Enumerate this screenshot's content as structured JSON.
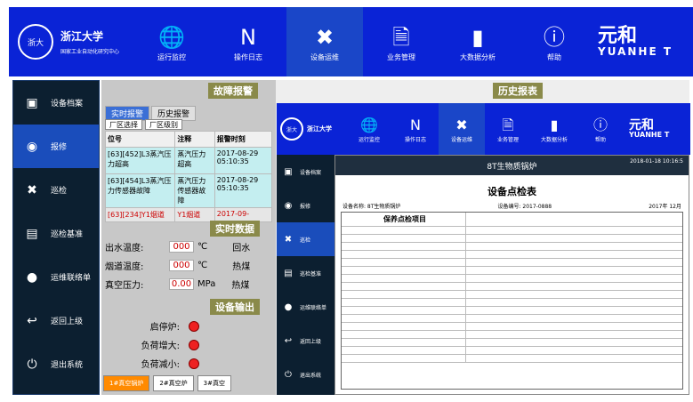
{
  "top": {
    "school": "浙江大学",
    "school_sub": "国家工业自动化研究中心",
    "logo_text": "浙大",
    "nav": [
      {
        "label": "运行监控",
        "icon": "globe-icon",
        "glyph": "🌐"
      },
      {
        "label": "操作日志",
        "icon": "notebook-icon",
        "glyph": "N"
      },
      {
        "label": "设备运维",
        "icon": "tools-icon",
        "glyph": "✖"
      },
      {
        "label": "业务管理",
        "icon": "document-search-icon",
        "glyph": "🗎"
      },
      {
        "label": "大数据分析",
        "icon": "bar-chart-icon",
        "glyph": "▮"
      },
      {
        "label": "帮助",
        "icon": "info-icon",
        "glyph": "ⓘ"
      }
    ],
    "brand_cn": "元和",
    "brand_en": "YUANHE T"
  },
  "sidebar": [
    {
      "label": "设备档案",
      "icon": "archive-icon",
      "glyph": "▣"
    },
    {
      "label": "报修",
      "icon": "repair-icon",
      "glyph": "◉"
    },
    {
      "label": "巡检",
      "icon": "inspection-icon",
      "glyph": "✖"
    },
    {
      "label": "巡检基准",
      "icon": "standard-icon",
      "glyph": "▤"
    },
    {
      "label": "运维联络单",
      "icon": "contact-icon",
      "glyph": "●"
    },
    {
      "label": "返回上级",
      "icon": "back-icon",
      "glyph": "↩"
    },
    {
      "label": "退出系统",
      "icon": "power-icon",
      "glyph": "⏻"
    }
  ],
  "fault": {
    "title": "故障报警",
    "tabs": [
      "实时报警",
      "历史报警"
    ],
    "filters": [
      "厂区选择",
      "厂区级别"
    ],
    "cols": [
      "位号",
      "注释",
      "报警时刻"
    ],
    "rows": [
      {
        "tag": "[63][452]L3蒸汽压力超高",
        "note": "蒸汽压力超高",
        "time": "2017-08-29 05:10:35"
      },
      {
        "tag": "[63][454]L3蒸汽压力传感器故障",
        "note": "蒸汽压力传感器故障",
        "time": "2017-08-29 05:10:35"
      },
      {
        "tag": "[63][234]Y1烟道",
        "note": "Y1烟道",
        "time": "2017-09-"
      }
    ]
  },
  "realtime": {
    "title": "实时数据",
    "items": [
      {
        "label": "出水温度:",
        "value": "000",
        "unit": "℃",
        "right": "回水"
      },
      {
        "label": "烟道温度:",
        "value": "000",
        "unit": "℃",
        "right": "热煤"
      },
      {
        "label": "真空压力:",
        "value": "0.00",
        "unit": "MPa",
        "right": "热煤"
      }
    ]
  },
  "output": {
    "title": "设备输出",
    "items": [
      "启停炉:",
      "负荷增大:",
      "负荷减小:"
    ]
  },
  "buttons": [
    "1#真空锅炉",
    "2#真空炉",
    "3#真空"
  ],
  "history": {
    "title": "历史报表",
    "header": "8T生物质锅炉",
    "timestamp": "2018-01-18 10:16:5",
    "doc_title": "设备点检表",
    "meta_left": "设备名称: 8T生物质锅炉",
    "meta_mid": "设备编号: 2017-0888",
    "meta_right": "2017年 12月",
    "item_col": "保养点检项目",
    "side": [
      "设备档案",
      "报修",
      "巡检",
      "巡检基准",
      "运维联络单",
      "返回上级",
      "退出系统"
    ]
  }
}
